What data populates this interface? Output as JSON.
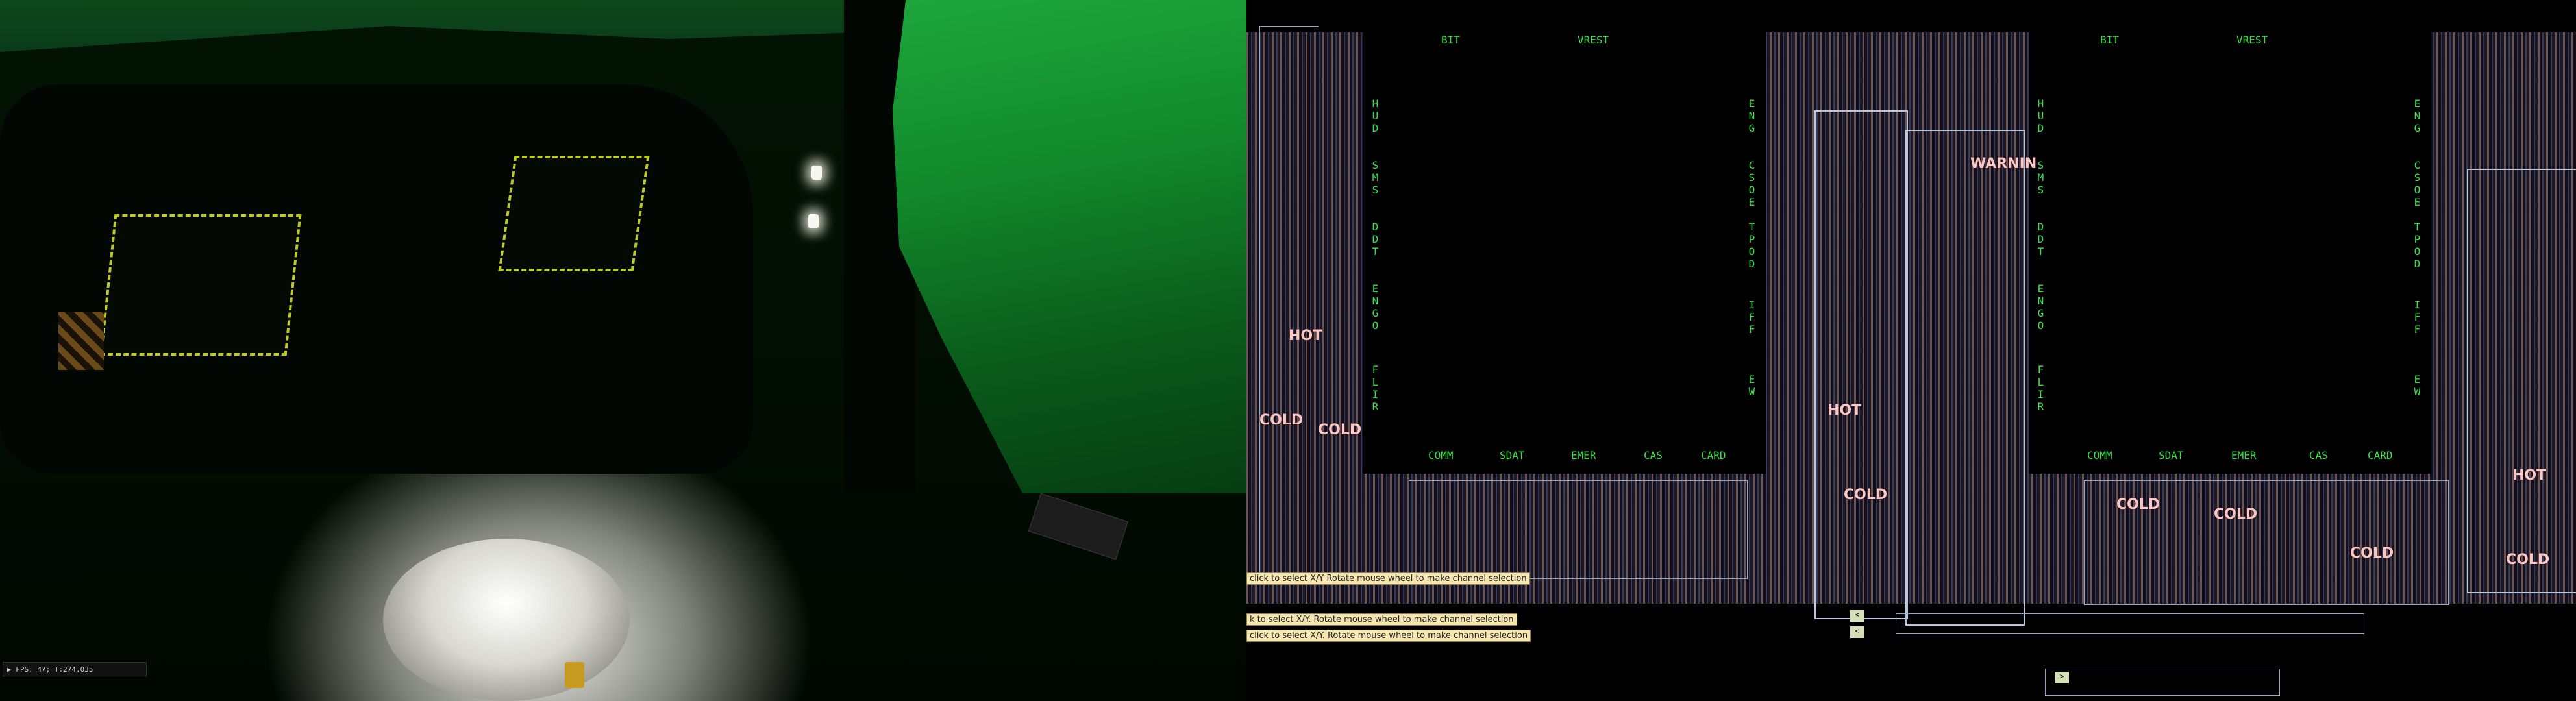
{
  "viewport": {
    "fps_text": "FPS: 47; T:274.035"
  },
  "debug_displays": [
    {
      "top_labels": [
        "BIT",
        "VREST"
      ],
      "left_labels": [
        "HUD",
        "SMS",
        "DDT",
        "ENGO",
        "FLIR"
      ],
      "right_labels": [
        "ENG",
        "CSOE",
        "TPOD",
        "IFF",
        "EW"
      ],
      "bottom_labels": [
        "COMM",
        "SDAT",
        "EMER",
        "CAS",
        "CARD"
      ]
    },
    {
      "top_labels": [
        "BIT",
        "VREST"
      ],
      "left_labels": [
        "HUD",
        "SMS",
        "DDT",
        "ENGO",
        "FLIR"
      ],
      "right_labels": [
        "ENG",
        "CSOE",
        "TPOD",
        "IFF",
        "EW"
      ],
      "bottom_labels": [
        "COMM",
        "SDAT",
        "EMER",
        "CAS",
        "CARD"
      ]
    }
  ],
  "tooltips": [
    "click to select X/Y Rotate mouse wheel to make channel selection",
    "k to select X/Y. Rotate mouse wheel to make channel selection",
    "click to select X/Y. Rotate mouse wheel to make channel selection"
  ],
  "stamps": {
    "warning": "WARNIN",
    "hot": "HOT",
    "cold": "COLD"
  },
  "colors": {
    "mfd_label": "#39e04a",
    "hud_dash": "#c6d628",
    "canopy_green": "#1ea83d",
    "tooltip_bg": "#f6e6b0"
  }
}
